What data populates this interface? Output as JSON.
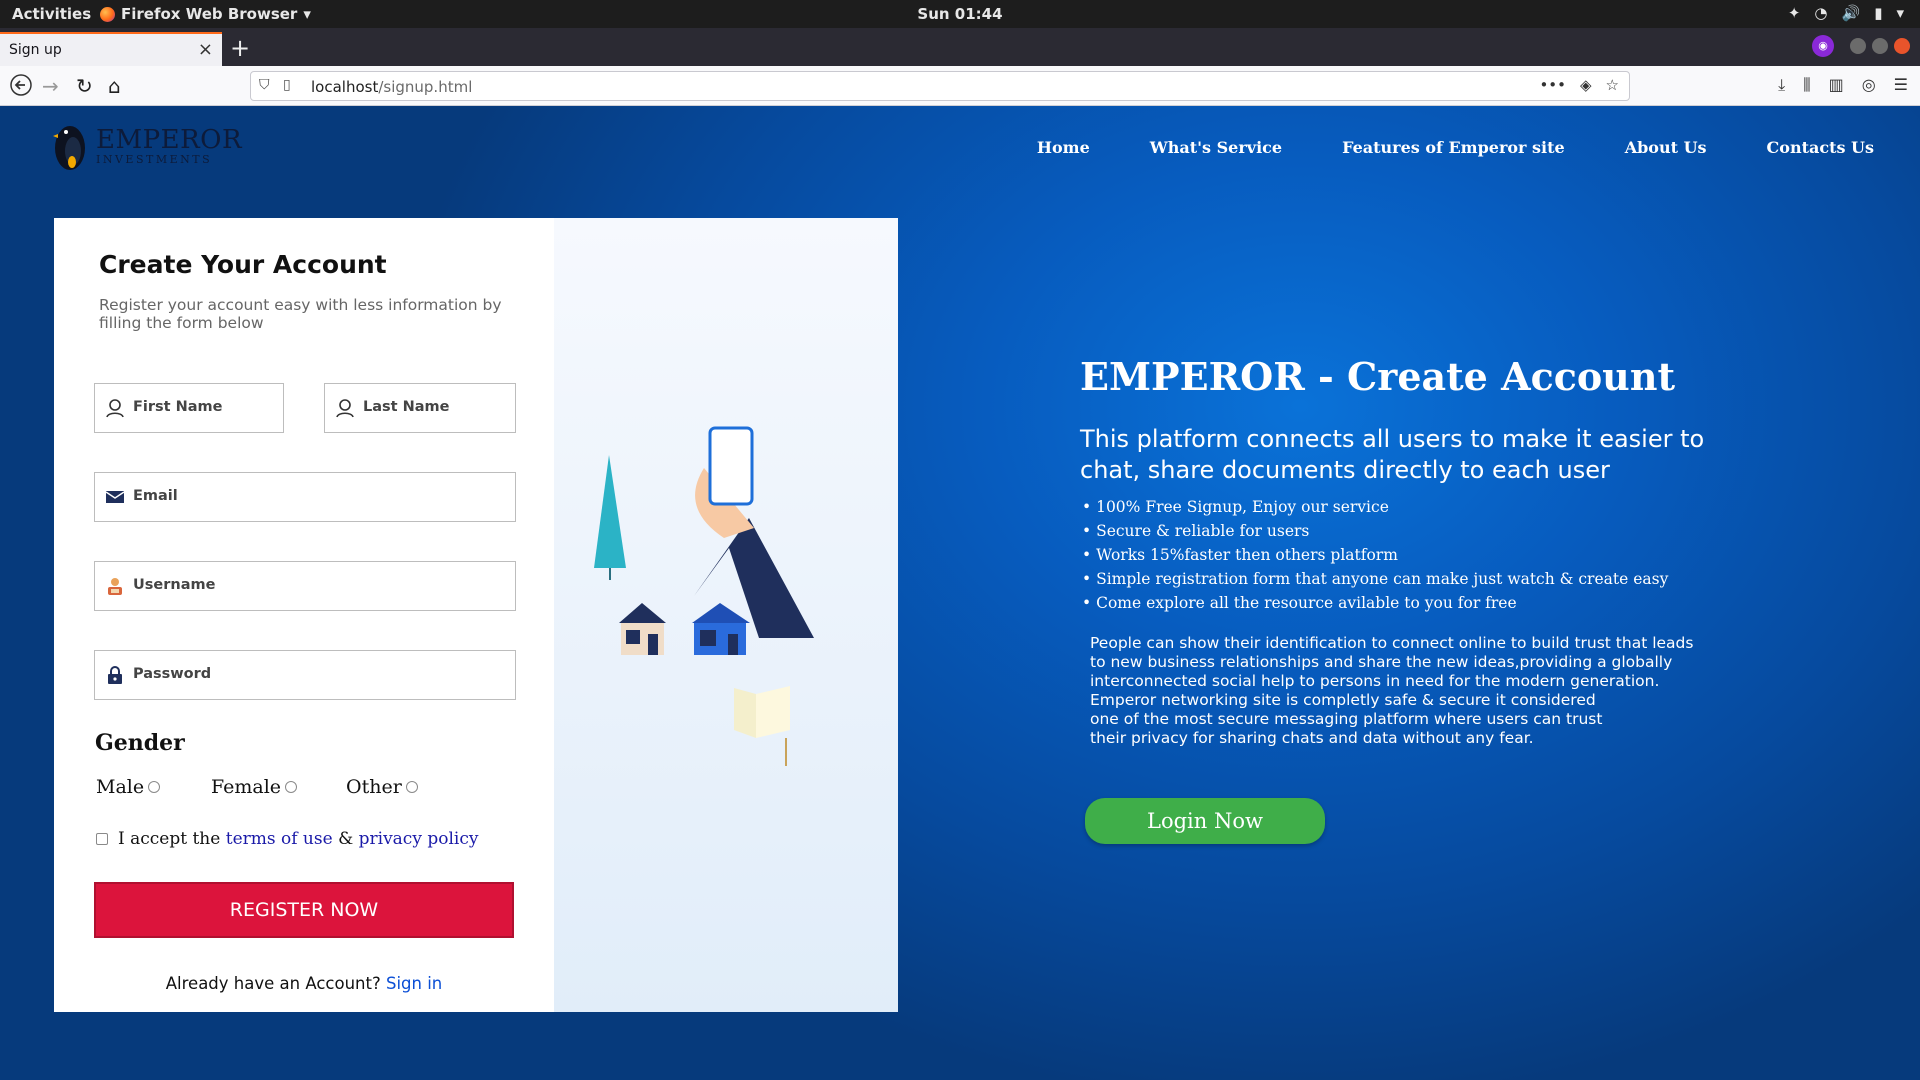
{
  "system": {
    "activities": "Activities",
    "app_name": "Firefox Web Browser",
    "clock": "Sun 01:44"
  },
  "browser": {
    "tab_title": "Sign up",
    "url_host": "localhost",
    "url_path": "/signup.html"
  },
  "site": {
    "brand_name": "EMPEROR",
    "brand_sub": "INVESTMENTS",
    "nav": [
      "Home",
      "What's Service",
      "Features of Emperor site",
      "About Us",
      "Contacts Us"
    ]
  },
  "form": {
    "title": "Create Your Account",
    "subtitle": "Register your account easy with less information by filling the form below",
    "first_name_placeholder": "First Name",
    "last_name_placeholder": "Last Name",
    "email_placeholder": "Email",
    "username_placeholder": "Username",
    "password_placeholder": "Password",
    "gender_title": "Gender",
    "gender_options": [
      "Male",
      "Female",
      "Other"
    ],
    "terms_prefix": "I accept the",
    "terms_link": "terms of use",
    "terms_and": "&",
    "privacy_link": "privacy policy",
    "register_label": "REGISTER NOW",
    "signin_prompt": "Already have an Account?",
    "signin_link": "Sign in"
  },
  "info": {
    "title": "EMPEROR - Create Account",
    "lead": "This platform connects all users to make it easier to chat, share documents directly to each user",
    "bullets": [
      "100% Free Signup, Enjoy our service",
      "Secure & reliable for users",
      "Works 15%faster then others platform",
      "Simple registration form that anyone can make just watch & create easy",
      "Come explore all the resource avilable to you for free"
    ],
    "paragraph_lines": [
      "People can show their identification to connect online to build trust that leads",
      "to new business relationships and share the new ideas,providing a globally",
      "interconnected social help to persons in need for the modern generation.",
      "Emperor networking site is completly safe & secure it considered",
      "one of the most secure messaging platform where users can trust",
      "their privacy for sharing chats and data without any fear."
    ],
    "login_label": "Login Now"
  },
  "colors": {
    "register_button": "#dc143c",
    "login_button": "#3fae49",
    "link": "#1a1aa8"
  }
}
